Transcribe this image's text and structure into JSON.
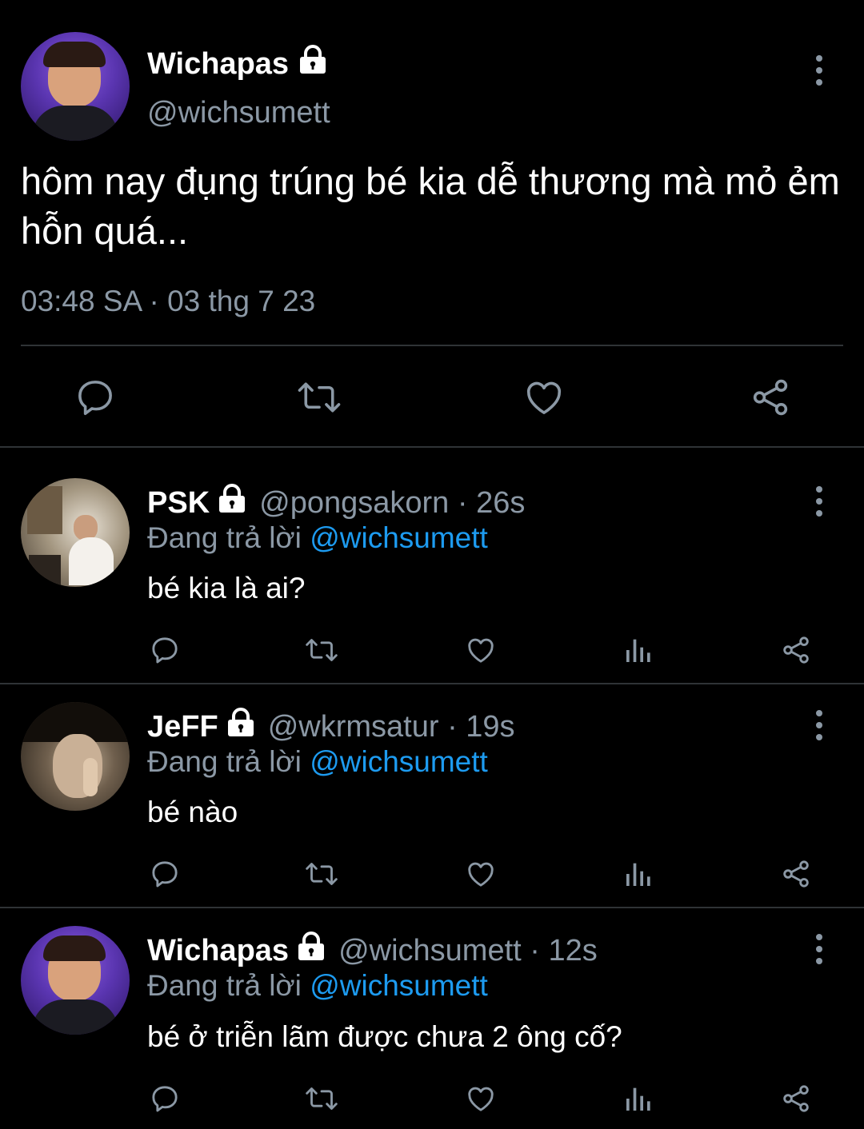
{
  "main_tweet": {
    "name": "Wichapas",
    "handle": "@wichsumett",
    "text": "hôm nay đụng trúng bé kia dễ thương mà mỏ ẻm hỗn quá...",
    "timestamp": "03:48 SA · 03 thg 7 23",
    "actions": [
      "reply-icon",
      "retweet-icon",
      "like-icon",
      "share-icon"
    ]
  },
  "replies": [
    {
      "name": "PSK",
      "handle": "@pongsakorn · 26s",
      "reply_prefix": "Đang trả lời",
      "reply_to": "@wichsumett",
      "text": "bé kia là ai?"
    },
    {
      "name": "JeFF",
      "handle": "@wkrmsatur · 19s",
      "reply_prefix": "Đang trả lời",
      "reply_to": "@wichsumett",
      "text": "bé nào"
    },
    {
      "name": "Wichapas",
      "handle": "@wichsumett · 12s",
      "reply_prefix": "Đang trả lời",
      "reply_to": "@wichsumett",
      "text": "bé ở triễn lãm được chưa 2 ông cố?"
    }
  ],
  "reply_actions": [
    "reply-icon",
    "retweet-icon",
    "like-icon",
    "views-icon",
    "share-icon"
  ],
  "colors": {
    "background": "#000000",
    "text": "#ffffff",
    "muted": "#8b98a5",
    "link": "#1d9bf0",
    "divider": "#2f3336"
  }
}
